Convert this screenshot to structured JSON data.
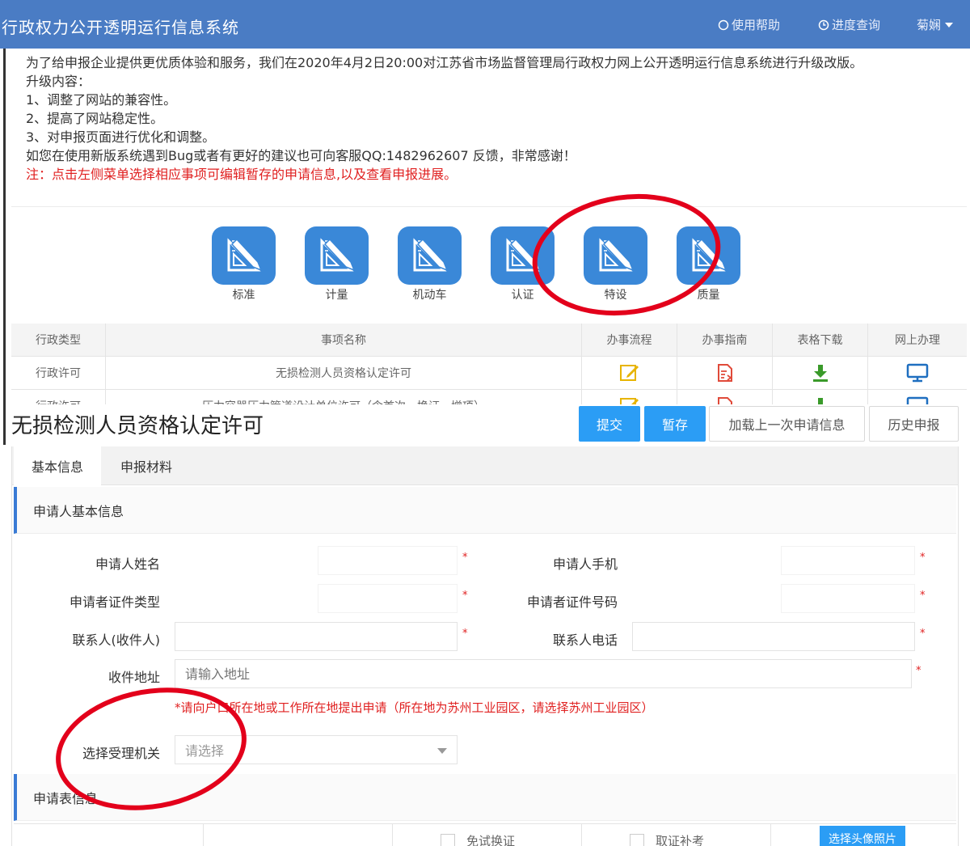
{
  "header": {
    "title": "行政权力公开透明运行信息系统",
    "help": "使用帮助",
    "progress": "进度查询",
    "user": "菊娴"
  },
  "notice": {
    "line1": "为了给申报企业提供更优质体验和服务，我们在2020年4月2日20:00对江苏省市场监督管理局行政权力网上公开透明运行信息系统进行升级改版。",
    "line2": "升级内容：",
    "line3": "1、调整了网站的兼容性。",
    "line4": "2、提高了网站稳定性。",
    "line5": "3、对申报页面进行优化和调整。",
    "line6": "如您在使用新版系统遇到Bug或者有更好的建议也可向客服QQ:1482962607 反馈，非常感谢！",
    "warning": "注：点击左侧菜单选择相应事项可编辑暂存的申请信息,以及查看申报进展。"
  },
  "categories": [
    {
      "label": "标准"
    },
    {
      "label": "计量"
    },
    {
      "label": "机动车"
    },
    {
      "label": "认证"
    },
    {
      "label": "特设"
    },
    {
      "label": "质量"
    }
  ],
  "matter_table": {
    "headers": [
      "行政类型",
      "事项名称",
      "办事流程",
      "办事指南",
      "表格下载",
      "网上办理"
    ],
    "rows": [
      {
        "type": "行政许可",
        "name": "无损检测人员资格认定许可"
      },
      {
        "type": "行政许可",
        "name": "压力容器压力管道设计单位许可（含首次、换证、增项）"
      }
    ]
  },
  "form": {
    "title": "无损检测人员资格认定许可",
    "buttons": {
      "submit": "提交",
      "save_draft": "暂存",
      "load_last": "加载上一次申请信息",
      "history": "历史申报"
    },
    "tabs": [
      "基本信息",
      "申报材料"
    ],
    "section_applicant": "申请人基本信息",
    "section_table": "申请表信息",
    "fields": {
      "applicant_name": "申请人姓名",
      "applicant_phone": "申请人手机",
      "id_type": "申请者证件类型",
      "id_number": "申请者证件号码",
      "contact": "联系人(收件人)",
      "contact_phone": "联系人电话",
      "address": "收件地址",
      "address_placeholder": "请输入地址",
      "authority": "选择受理机关",
      "authority_placeholder": "请选择"
    },
    "required_mark": "*",
    "hint": "*请向户口所在地或工作所在地提出申请（所在地为苏州工业园区，请选择苏州工业园区）",
    "bottom": {
      "exam_exempt": "免试换证",
      "cert_makeup": "取证补考",
      "photo_button": "选择头像照片"
    }
  },
  "colors": {
    "header_bg": "#4a7cc4",
    "tile_bg": "#3a88d8",
    "primary_button": "#2b9df5",
    "warning_text": "#e02020",
    "annotation": "#e3001b"
  },
  "icons": {
    "help": "circle-icon",
    "progress": "clock-icon",
    "user_menu": "caret-down-icon",
    "category": "pencil-ruler-icon",
    "process": "edit-icon",
    "guide": "document-icon",
    "download": "download-icon",
    "online": "monitor-icon"
  }
}
